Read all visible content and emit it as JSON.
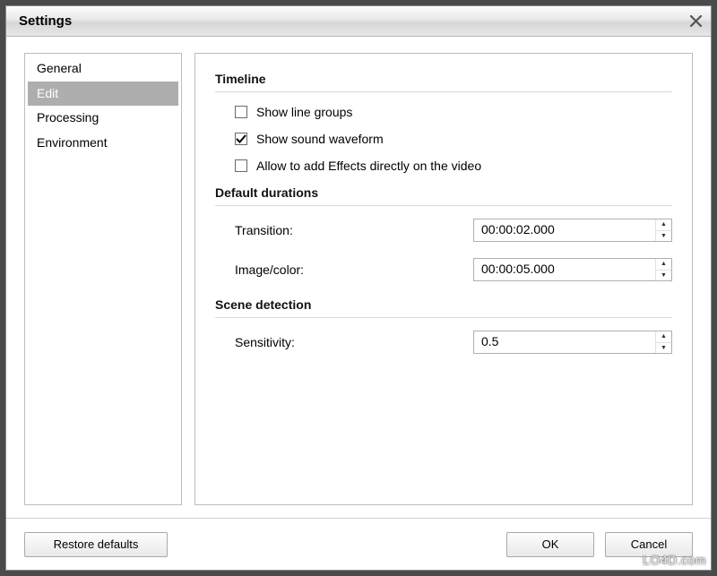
{
  "window": {
    "title": "Settings"
  },
  "nav": {
    "items": [
      {
        "label": "General"
      },
      {
        "label": "Edit"
      },
      {
        "label": "Processing"
      },
      {
        "label": "Environment"
      }
    ],
    "selected_index": 1
  },
  "sections": {
    "timeline": {
      "title": "Timeline",
      "checks": {
        "show_line_groups": {
          "label": "Show line groups",
          "checked": false
        },
        "show_sound_waveform": {
          "label": "Show sound waveform",
          "checked": true
        },
        "allow_effects_on_video": {
          "label": "Allow to add Effects directly on the video",
          "checked": false
        }
      }
    },
    "default_durations": {
      "title": "Default durations",
      "transition": {
        "label": "Transition:",
        "value": "00:00:02.000"
      },
      "image_color": {
        "label": "Image/color:",
        "value": "00:00:05.000"
      }
    },
    "scene_detection": {
      "title": "Scene detection",
      "sensitivity": {
        "label": "Sensitivity:",
        "value": "0.5"
      }
    }
  },
  "buttons": {
    "restore_defaults": "Restore defaults",
    "ok": "OK",
    "cancel": "Cancel"
  },
  "watermark": "LO4D.com"
}
